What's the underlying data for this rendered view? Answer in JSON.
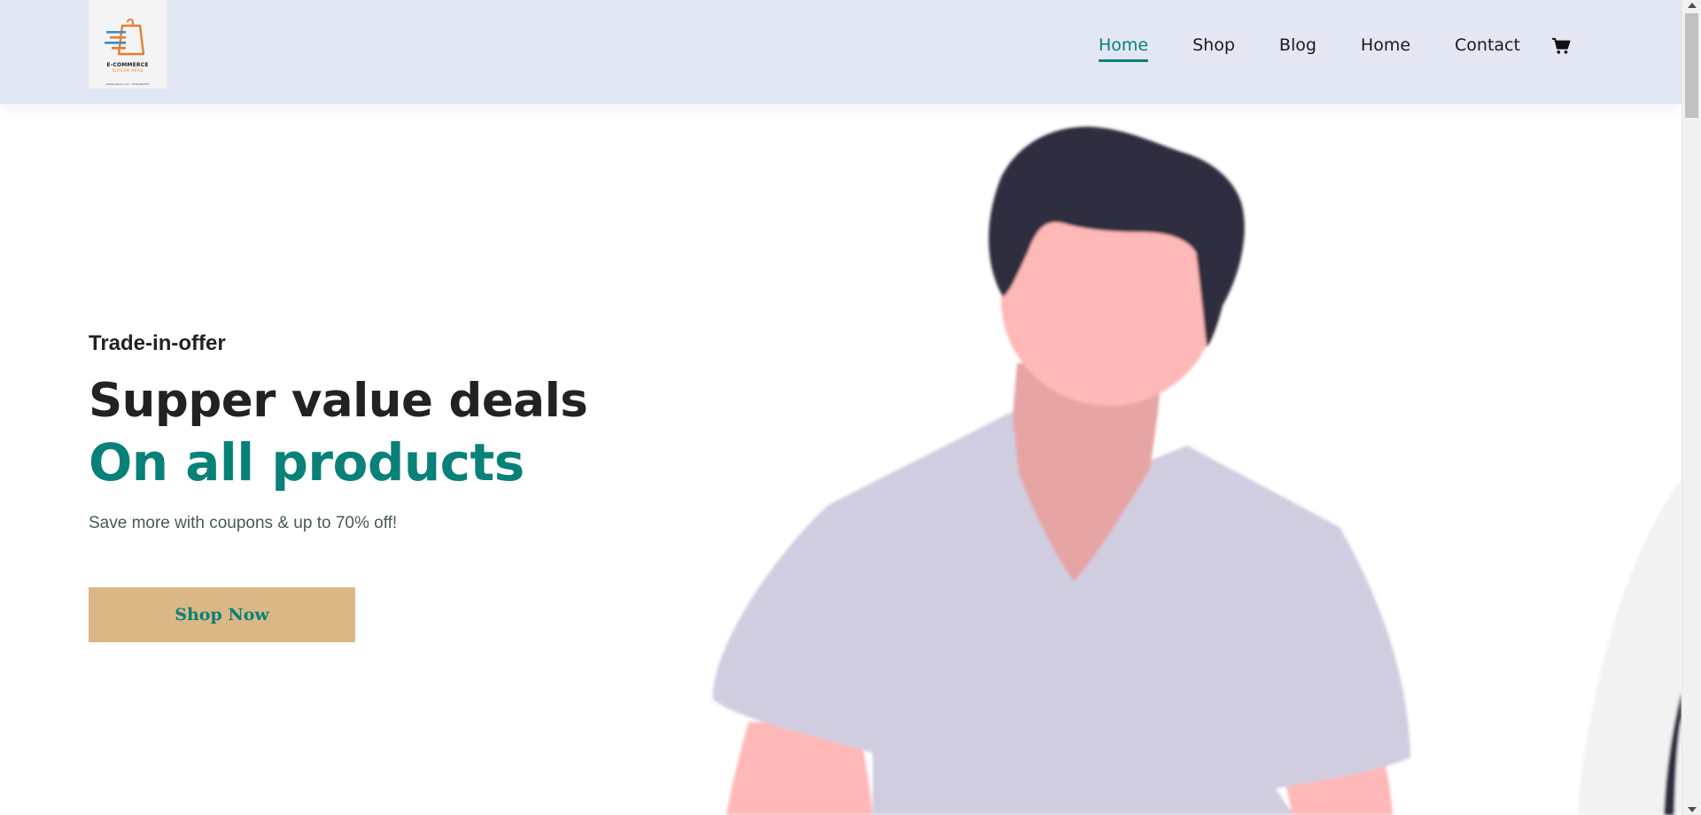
{
  "logo": {
    "name": "E-COMMERCE",
    "slogan": "SLOGAN HERE",
    "footnote": "shutterstock.com · 2244300753"
  },
  "nav": {
    "items": [
      "Home",
      "Shop",
      "Blog",
      "Home",
      "Contact"
    ],
    "active_index": 0,
    "cart_icon": "cart-icon"
  },
  "hero": {
    "eyebrow": "Trade-in-offer",
    "headline": "Supper value deals",
    "headline_accent": "On all products",
    "subtext": "Save more with coupons & up to 70% off!",
    "button_label": "Shop Now"
  },
  "colors": {
    "accent": "#088178",
    "header_bg": "#e3e6f3",
    "button_bg": "#dcb786",
    "hair": "#2f2e41",
    "skin": "#ffb8b8",
    "shirt": "#d0cde1"
  }
}
